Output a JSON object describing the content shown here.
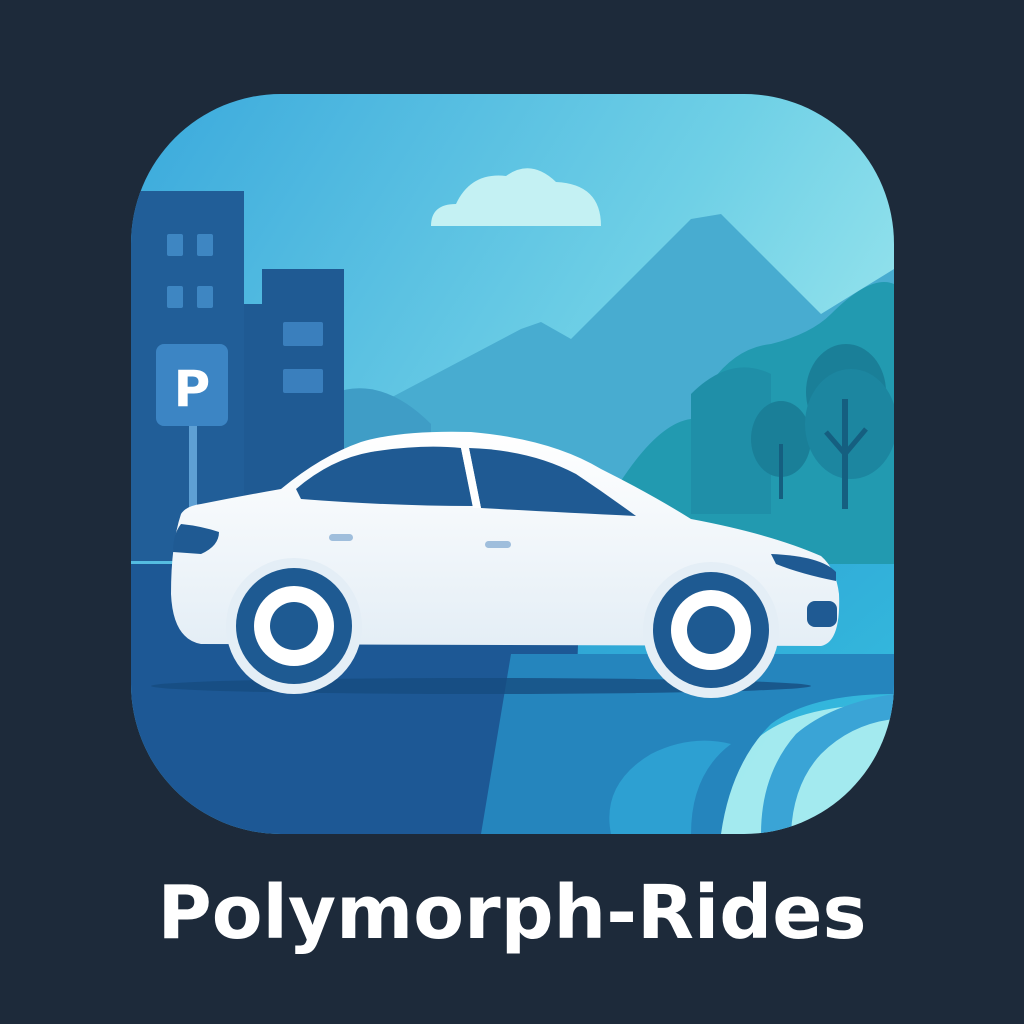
{
  "app": {
    "name": "Polymorph-Rides"
  },
  "icon": {
    "parking_sign_letter": "P",
    "depicts": [
      "building-icon",
      "parking-sign-icon",
      "car-icon",
      "mountain-icon",
      "tree-icon",
      "cloud-icon",
      "road-icon",
      "river-icon"
    ]
  },
  "colors": {
    "background": "#1d2a3a",
    "sky_top": "#3fb3e0",
    "sky_bottom": "#9ee6ec",
    "building": "#1f5a94",
    "car_body": "#ffffff",
    "wheel": "#1e5a92",
    "water": "#2fb0d8",
    "label": "#ffffff"
  }
}
